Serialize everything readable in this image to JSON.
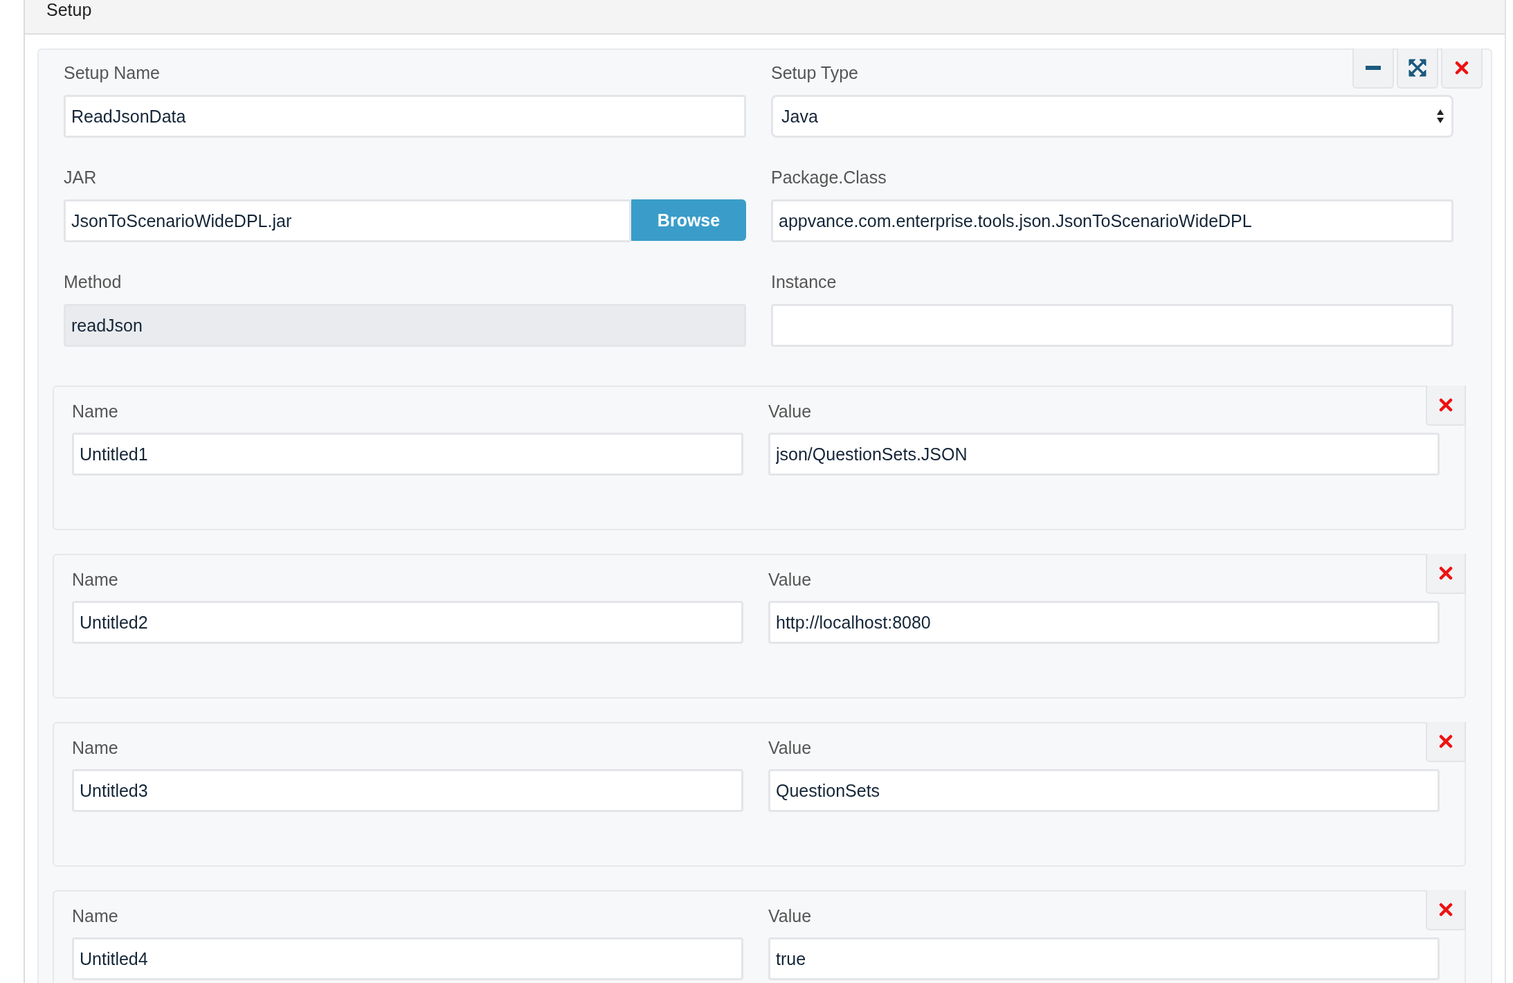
{
  "header": {
    "title": "Setup"
  },
  "setup": {
    "toolbar": [
      {
        "kind": "minimize"
      },
      {
        "kind": "expand"
      },
      {
        "kind": "remove"
      }
    ],
    "fields": [
      {
        "kind": "text",
        "label": "Setup Name",
        "value": "ReadJsonData",
        "disabled": false
      },
      {
        "kind": "select",
        "label": "Setup Type",
        "value": "Java"
      },
      {
        "kind": "file",
        "label": "JAR",
        "value": "JsonToScenarioWideDPL.jar",
        "button": "Browse"
      },
      {
        "kind": "text",
        "label": "Package.Class",
        "value": "appvance.com.enterprise.tools.json.JsonToScenarioWideDPL",
        "disabled": false
      },
      {
        "kind": "text",
        "label": "Method",
        "value": "readJson",
        "disabled": true
      },
      {
        "kind": "text",
        "label": "Instance",
        "disabled": false
      }
    ]
  },
  "parameters": [
    {
      "name_label": "Name",
      "name": "Untitled1",
      "value_label": "Value",
      "value": "json/QuestionSets.JSON"
    },
    {
      "name_label": "Name",
      "name": "Untitled2",
      "value_label": "Value",
      "value": "http://localhost:8080"
    },
    {
      "name_label": "Name",
      "name": "Untitled3",
      "value_label": "Value",
      "value": "QuestionSets"
    },
    {
      "name_label": "Name",
      "name": "Untitled4",
      "value_label": "Value",
      "value": "true"
    }
  ]
}
